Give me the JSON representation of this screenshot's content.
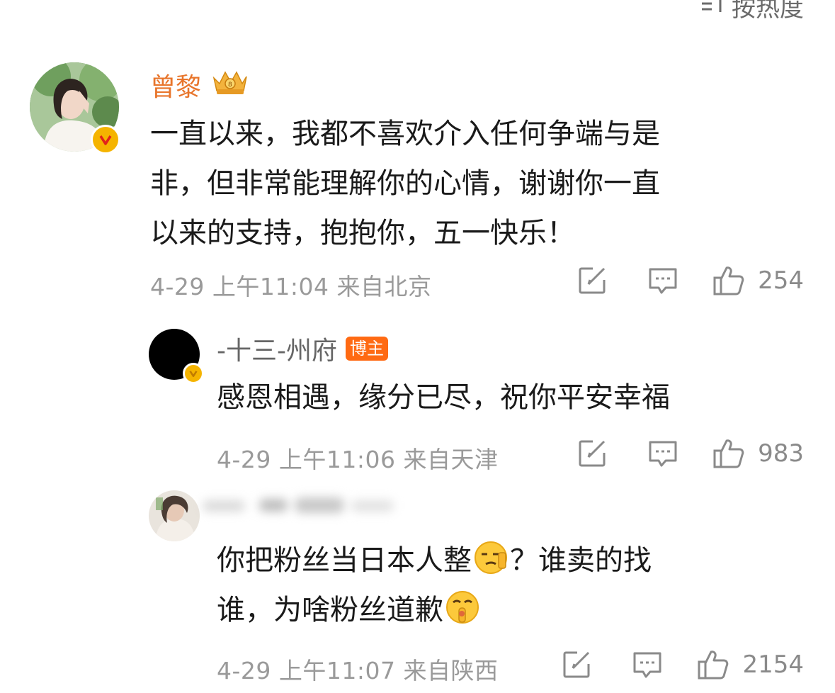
{
  "sort_label": "按热度",
  "comments": [
    {
      "name": "曾黎",
      "body_lines": [
        "一直以来，我都不喜欢介入任何争端与是",
        "非，但非常能理解你的心情，谢谢你一直",
        "以来的支持，抱抱你，五一快乐！"
      ],
      "date": "4-29",
      "time": "上午11:04",
      "location": "来自北京",
      "likes": "254"
    },
    {
      "name": "-十三-州府",
      "tag": "博主",
      "body_lines": [
        "感恩相遇，缘分已尽，祝你平安幸福"
      ],
      "date": "4-29",
      "time": "上午11:06",
      "location": "来自天津",
      "likes": "983"
    },
    {
      "body_line1": "你把粉丝当日本人整",
      "body_line1b": "？谁卖的找",
      "body_line2": "谁，为啥粉丝道歉",
      "date": "4-29",
      "time": "上午11:07",
      "location": "来自陕西",
      "likes": "2154"
    }
  ],
  "colors": {
    "name_orange": "#e8752b",
    "meta_gray": "#9a9a9a",
    "verified_gold": "#f5b400",
    "author_tag": "#ff6a13"
  }
}
